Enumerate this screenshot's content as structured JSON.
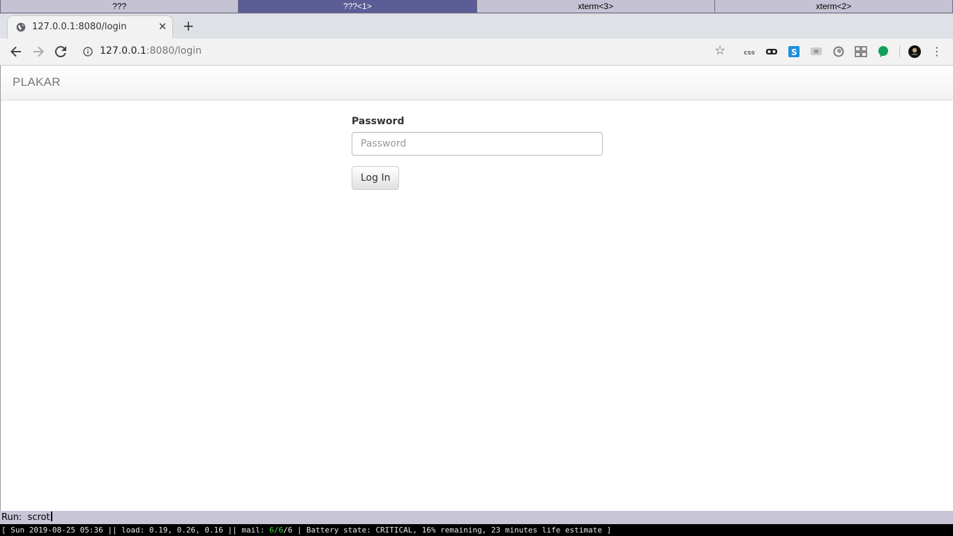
{
  "wm": {
    "tabs": [
      {
        "label": "???",
        "active": false
      },
      {
        "label": "???<1>",
        "active": true
      },
      {
        "label": "xterm<3>",
        "active": false
      },
      {
        "label": "xterm<2>",
        "active": false
      }
    ]
  },
  "browser": {
    "tab_title": "127.0.0.1:8080/login",
    "tab_favicon": "globe-icon",
    "url_host": "127.0.0.1",
    "url_rest": ":8080/login",
    "extensions": [
      "css-viewer-icon",
      "incognito-mask-icon",
      "skype-icon",
      "screen-share-icon",
      "circle-icon",
      "grid-icon",
      "green-bubble-icon",
      "profile-avatar-icon"
    ]
  },
  "page": {
    "brand": "PLAKAR",
    "password_label": "Password",
    "password_placeholder": "Password",
    "login_button": "Log In"
  },
  "run_prompt": {
    "label": "Run:",
    "command": "scrot"
  },
  "status": {
    "prefix": "[ Sun 2019-08-25 05:36 || load: 0.19, 0.26, 0.16 || mail: ",
    "mail_a": "6",
    "mail_sep1": "/",
    "mail_b": "6",
    "mail_sep2": "/",
    "mail_c": "6",
    "suffix": " | Battery state: CRITICAL, 16% remaining, 23 minutes life estimate ]"
  },
  "colors": {
    "wm_active": "#5c5c96",
    "wm_inactive": "#c5c3d3",
    "status_green": "#3ddc3d"
  }
}
